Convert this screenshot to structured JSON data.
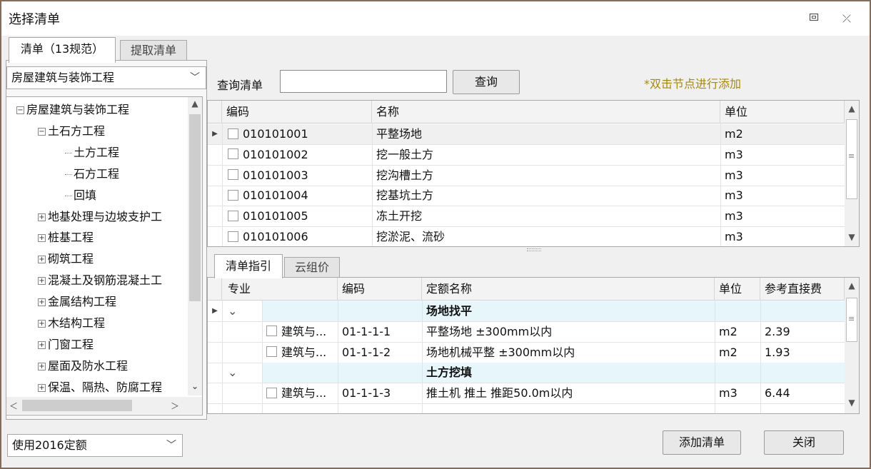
{
  "window": {
    "title": "选择清单",
    "restore_icon": "restore-icon",
    "close_icon": "close-icon",
    "close_glyph": "⤫"
  },
  "tabs": [
    {
      "label": "清单（13规范）"
    },
    {
      "label": "提取清单"
    }
  ],
  "left": {
    "category_select": "房屋建筑与装饰工程",
    "tree": [
      {
        "label": "房屋建筑与装饰工程",
        "level": 0,
        "toggle": "-"
      },
      {
        "label": "土石方工程",
        "level": 1,
        "toggle": "-"
      },
      {
        "label": "土方工程",
        "level": 2,
        "toggle": ""
      },
      {
        "label": "石方工程",
        "level": 2,
        "toggle": ""
      },
      {
        "label": "回填",
        "level": 2,
        "toggle": ""
      },
      {
        "label": "地基处理与边坡支护工",
        "level": 1,
        "toggle": "+"
      },
      {
        "label": "桩基工程",
        "level": 1,
        "toggle": "+"
      },
      {
        "label": "砌筑工程",
        "level": 1,
        "toggle": "+"
      },
      {
        "label": "混凝土及钢筋混凝土工",
        "level": 1,
        "toggle": "+"
      },
      {
        "label": "金属结构工程",
        "level": 1,
        "toggle": "+"
      },
      {
        "label": "木结构工程",
        "level": 1,
        "toggle": "+"
      },
      {
        "label": "门窗工程",
        "level": 1,
        "toggle": "+"
      },
      {
        "label": "屋面及防水工程",
        "level": 1,
        "toggle": "+"
      },
      {
        "label": "保温、隔热、防腐工程",
        "level": 1,
        "toggle": "+"
      }
    ]
  },
  "search": {
    "label": "查询清单",
    "value": "",
    "button": "查询",
    "hint": "*双击节点进行添加"
  },
  "list_grid": {
    "columns": [
      "编码",
      "名称",
      "单位"
    ],
    "rows": [
      {
        "code": "010101001",
        "name": "平整场地",
        "unit": "m2"
      },
      {
        "code": "010101002",
        "name": "挖一般土方",
        "unit": "m3"
      },
      {
        "code": "010101003",
        "name": "挖沟槽土方",
        "unit": "m3"
      },
      {
        "code": "010101004",
        "name": "挖基坑土方",
        "unit": "m3"
      },
      {
        "code": "010101005",
        "name": "冻土开挖",
        "unit": "m3"
      },
      {
        "code": "010101006",
        "name": "挖淤泥、流砂",
        "unit": "m3"
      }
    ]
  },
  "bottom_tabs": [
    {
      "label": "清单指引"
    },
    {
      "label": "云组价"
    }
  ],
  "guide_grid": {
    "columns": [
      "专业",
      "编码",
      "定额名称",
      "单位",
      "参考直接费"
    ],
    "rows": [
      {
        "type": "group",
        "name": "场地找平"
      },
      {
        "type": "item",
        "major": "建筑与...",
        "code": "01-1-1-1",
        "name": "平整场地 ±300mm以内",
        "unit": "m2",
        "fee": "2.39"
      },
      {
        "type": "item",
        "major": "建筑与...",
        "code": "01-1-1-2",
        "name": "场地机械平整 ±300mm以内",
        "unit": "m2",
        "fee": "1.93"
      },
      {
        "type": "group",
        "name": "土方挖填"
      },
      {
        "type": "item",
        "major": "建筑与...",
        "code": "01-1-1-3",
        "name": "推土机 推土 推距50.0m以内",
        "unit": "m3",
        "fee": "6.44"
      }
    ]
  },
  "footer": {
    "quota_select": "使用2016定额",
    "add_button": "添加清单",
    "close_button": "关闭"
  }
}
